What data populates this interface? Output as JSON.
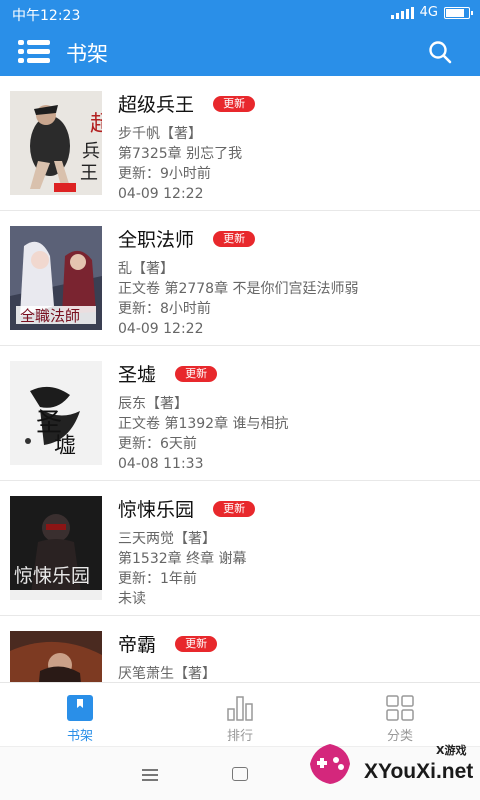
{
  "status": {
    "time": "中午12:23",
    "network": "4G"
  },
  "appbar": {
    "title": "书架"
  },
  "books": [
    {
      "title": "超级兵王",
      "badge": "更新",
      "author": "步千帆【著】",
      "chapter": "第7325章 别忘了我",
      "updated": "更新：9小时前",
      "date": "04-09 12:22"
    },
    {
      "title": "全职法师",
      "badge": "更新",
      "author": "乱【著】",
      "chapter": "正文卷 第2778章 不是你们宫廷法师弱",
      "updated": "更新：8小时前",
      "date": "04-09 12:22"
    },
    {
      "title": "圣墟",
      "badge": "更新",
      "author": "辰东【著】",
      "chapter": "正文卷 第1392章 谁与相抗",
      "updated": "更新：6天前",
      "date": "04-08 11:33"
    },
    {
      "title": "惊悚乐园",
      "badge": "更新",
      "author": "三天两觉【著】",
      "chapter": "第1532章 终章 谢幕",
      "updated": "更新：1年前",
      "date": "未读"
    },
    {
      "title": "帝霸",
      "badge": "更新",
      "author": "厌笔萧生【著】"
    }
  ],
  "tabs": [
    {
      "label": "书架",
      "icon": "bookmark-icon",
      "active": true
    },
    {
      "label": "排行",
      "icon": "bar-chart-icon",
      "active": false
    },
    {
      "label": "分类",
      "icon": "grid-icon",
      "active": false
    }
  ],
  "watermark": {
    "small": "X游戏",
    "big": "XYouXi.net"
  },
  "colors": {
    "primary": "#2a8fe8",
    "badge": "#e8282c"
  }
}
